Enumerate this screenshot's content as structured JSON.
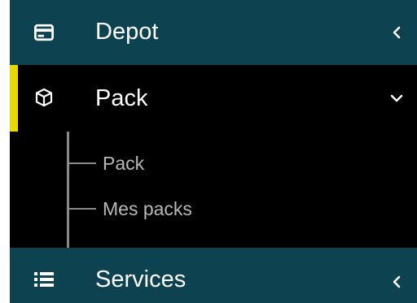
{
  "sidebar": {
    "items": [
      {
        "label": "Depot",
        "icon": "card-icon",
        "chevron": "chevron-left-icon",
        "expanded": false
      },
      {
        "label": "Pack",
        "icon": "box-icon",
        "chevron": "chevron-down-icon",
        "expanded": true,
        "active": true,
        "children": [
          {
            "label": "Pack"
          },
          {
            "label": "Mes packs"
          }
        ]
      },
      {
        "label": "Services",
        "icon": "list-icon",
        "chevron": "chevron-left-icon",
        "expanded": false
      }
    ]
  },
  "colors": {
    "menu_bg": "#0d4251",
    "active_bg": "#000000",
    "active_accent": "#e9d800",
    "label_text": "#ffffff",
    "sub_text": "#b8b8b8",
    "tree_line": "#8a8a8a"
  }
}
